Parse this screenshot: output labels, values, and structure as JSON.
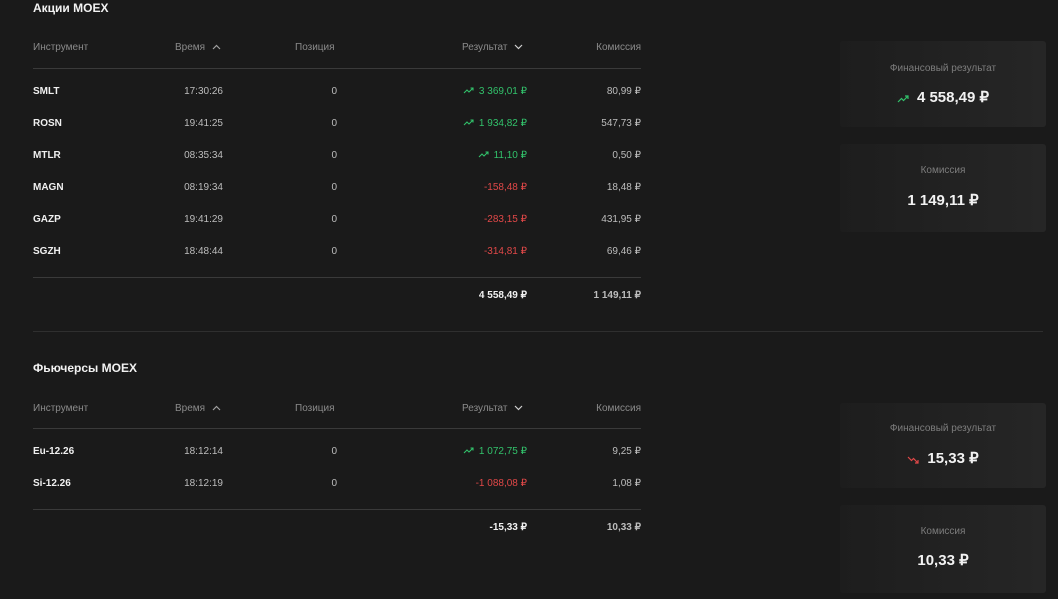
{
  "colors": {
    "positive": "#32c26b",
    "negative": "#e04848",
    "background": "#1a1a1a"
  },
  "sections": [
    {
      "title": "Акции MOEX",
      "headers": {
        "instrument": "Инструмент",
        "time": "Время",
        "position": "Позиция",
        "result": "Результат",
        "commission": "Комиссия"
      },
      "rows": [
        {
          "symbol": "SMLT",
          "time": "17:30:26",
          "position": "0",
          "result": "3 369,01 ₽",
          "trend": "up",
          "commission": "80,99 ₽"
        },
        {
          "symbol": "ROSN",
          "time": "19:41:25",
          "position": "0",
          "result": "1 934,82 ₽",
          "trend": "up",
          "commission": "547,73 ₽"
        },
        {
          "symbol": "MTLR",
          "time": "08:35:34",
          "position": "0",
          "result": "11,10 ₽",
          "trend": "up",
          "commission": "0,50 ₽"
        },
        {
          "symbol": "MAGN",
          "time": "08:19:34",
          "position": "0",
          "result": "-158,48 ₽",
          "trend": "down",
          "commission": "18,48 ₽"
        },
        {
          "symbol": "GAZP",
          "time": "19:41:29",
          "position": "0",
          "result": "-283,15 ₽",
          "trend": "down",
          "commission": "431,95 ₽"
        },
        {
          "symbol": "SGZH",
          "time": "18:48:44",
          "position": "0",
          "result": "-314,81 ₽",
          "trend": "down",
          "commission": "69,46 ₽"
        }
      ],
      "totals": {
        "result": "4 558,49 ₽",
        "commission": "1 149,11 ₽"
      },
      "cards": {
        "result_label": "Финансовый результат",
        "result_value": "4 558,49 ₽",
        "result_trend": "up",
        "commission_label": "Комиссия",
        "commission_value": "1 149,11 ₽"
      }
    },
    {
      "title": "Фьючерсы MOEX",
      "headers": {
        "instrument": "Инструмент",
        "time": "Время",
        "position": "Позиция",
        "result": "Результат",
        "commission": "Комиссия"
      },
      "rows": [
        {
          "symbol": "Eu-12.26",
          "time": "18:12:14",
          "position": "0",
          "result": "1 072,75 ₽",
          "trend": "up",
          "commission": "9,25 ₽"
        },
        {
          "symbol": "Si-12.26",
          "time": "18:12:19",
          "position": "0",
          "result": "-1 088,08 ₽",
          "trend": "down",
          "commission": "1,08 ₽"
        }
      ],
      "totals": {
        "result": "-15,33 ₽",
        "commission": "10,33 ₽"
      },
      "cards": {
        "result_label": "Финансовый результат",
        "result_value": "15,33 ₽",
        "result_trend": "down",
        "commission_label": "Комиссия",
        "commission_value": "10,33 ₽"
      }
    }
  ]
}
